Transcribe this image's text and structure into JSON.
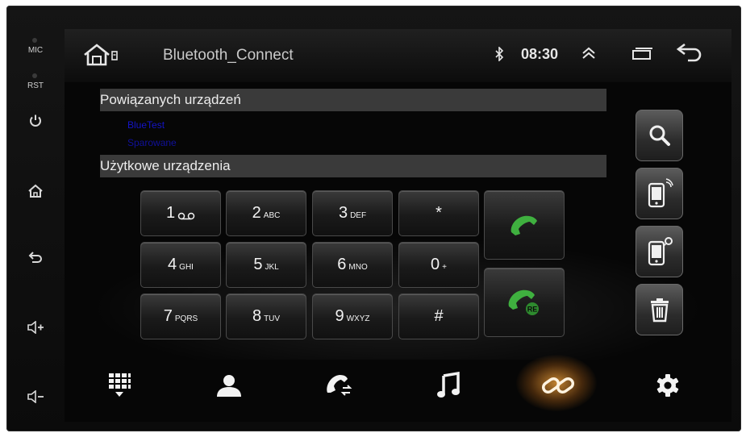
{
  "side_panel": {
    "mic_label": "MIC",
    "rst_label": "RST",
    "buttons": [
      "power-icon",
      "home-icon",
      "back-icon",
      "volume-up-icon",
      "volume-down-icon"
    ]
  },
  "status_bar": {
    "title": "Bluetooth_Connect",
    "time": "08:30",
    "icons": [
      "home-icon",
      "bluetooth-icon",
      "chevron-up-icon",
      "recent-apps-icon",
      "back-icon"
    ]
  },
  "paired": {
    "header": "Powiązanych urządzeń",
    "device_name": "BlueTest",
    "device_status": "Sparowane"
  },
  "available": {
    "header": "Użytkowe urządzenia"
  },
  "keypad": {
    "keys": [
      {
        "digit": "1",
        "letters": ""
      },
      {
        "digit": "2",
        "letters": "ABC"
      },
      {
        "digit": "3",
        "letters": "DEF"
      },
      {
        "digit": "*",
        "letters": ""
      },
      {
        "digit": "4",
        "letters": "GHI"
      },
      {
        "digit": "5",
        "letters": "JKL"
      },
      {
        "digit": "6",
        "letters": "MNO"
      },
      {
        "digit": "0",
        "letters": "+"
      },
      {
        "digit": "7",
        "letters": "PQRS"
      },
      {
        "digit": "8",
        "letters": "TUV"
      },
      {
        "digit": "9",
        "letters": "WXYZ"
      },
      {
        "digit": "#",
        "letters": ""
      }
    ],
    "redial_badge": "RE"
  },
  "colors": {
    "accent_green": "#3fb03f",
    "link_active": "#ff9a2e",
    "device_text": "#1414c8"
  },
  "right_toolbar": [
    "search-icon",
    "phone-discoverable-icon",
    "phone-connect-icon",
    "trash-icon"
  ],
  "bottom_nav": [
    "dialpad-icon",
    "contacts-icon",
    "call-log-icon",
    "music-icon",
    "link-icon",
    "settings-icon"
  ],
  "active_tab": "link-icon"
}
